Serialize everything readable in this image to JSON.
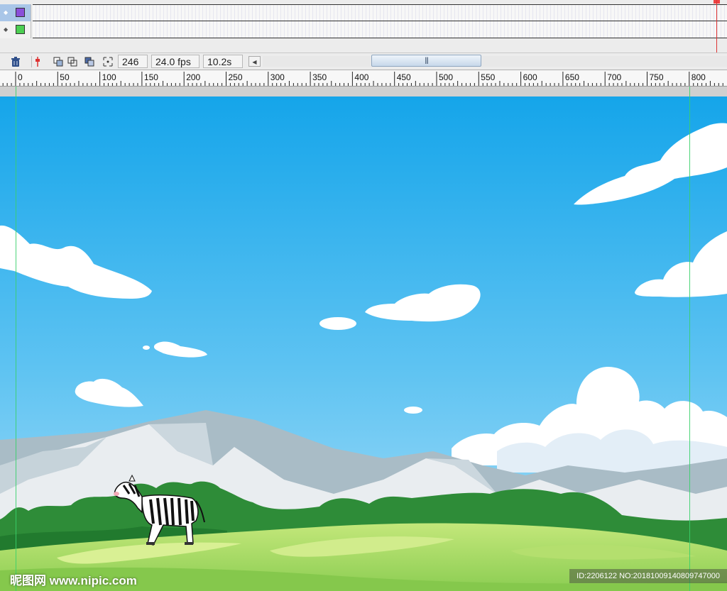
{
  "timeline": {
    "layers": [
      {
        "swatch_color": "#8a4fd9",
        "selected": true
      },
      {
        "swatch_color": "#4ccf53",
        "selected": false
      }
    ]
  },
  "toolbar": {
    "current_frame": "246",
    "frame_rate": "24.0 fps",
    "elapsed_time": "10.2s"
  },
  "ruler": {
    "labels": [
      "0",
      "50",
      "100",
      "150",
      "200",
      "250",
      "300",
      "350",
      "400",
      "450",
      "500",
      "550",
      "600",
      "650",
      "700",
      "750",
      "800"
    ]
  },
  "watermark": {
    "site": "昵图网 www.nipic.com",
    "id": "ID:2206122 NO:20181009140809747000"
  },
  "colors": {
    "sky_top": "#15a5ea",
    "sky_bottom": "#9fdaf7",
    "grass": "#9fd862",
    "trees": "#2e8c38",
    "guide": "#39d06a"
  }
}
